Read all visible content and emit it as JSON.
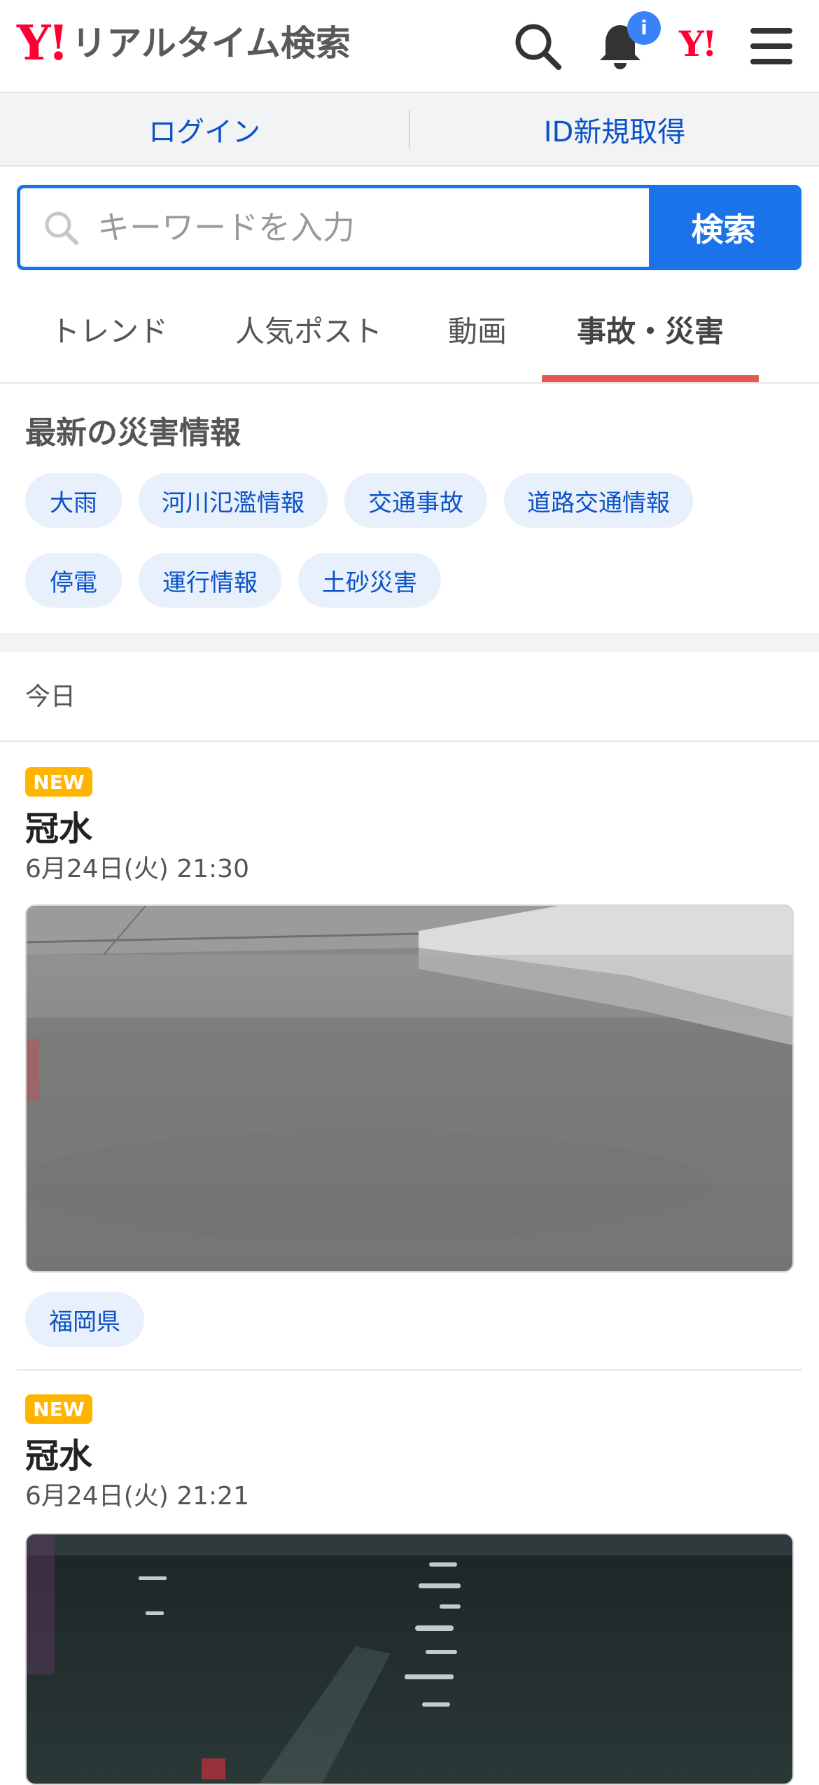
{
  "header": {
    "logo_y": "Y!",
    "title": "リアルタイム検索",
    "notification_badge": "i",
    "yahoo_mark": "Y!"
  },
  "login_bar": {
    "login": "ログイン",
    "signup": "ID新規取得"
  },
  "search": {
    "placeholder": "キーワードを入力",
    "button": "検索"
  },
  "tabs": [
    {
      "label": "トレンド",
      "active": false
    },
    {
      "label": "人気ポスト",
      "active": false
    },
    {
      "label": "動画",
      "active": false
    },
    {
      "label": "事故・災害",
      "active": true
    }
  ],
  "disaster": {
    "title": "最新の災害情報",
    "chips": [
      "大雨",
      "河川氾濫情報",
      "交通事故",
      "道路交通情報",
      "停電",
      "運行情報",
      "土砂災害"
    ]
  },
  "feed": {
    "day_label": "今日",
    "posts": [
      {
        "badge": "NEW",
        "title": "冠水",
        "time": "6月24日(火) 21:30",
        "location": "福岡県"
      },
      {
        "badge": "NEW",
        "title": "冠水",
        "time": "6月24日(火) 21:21"
      }
    ]
  },
  "colors": {
    "brand_red": "#ff0033",
    "accent_blue": "#1a73e8",
    "tab_underline": "#e25a4e",
    "new_badge": "#ffb400"
  }
}
